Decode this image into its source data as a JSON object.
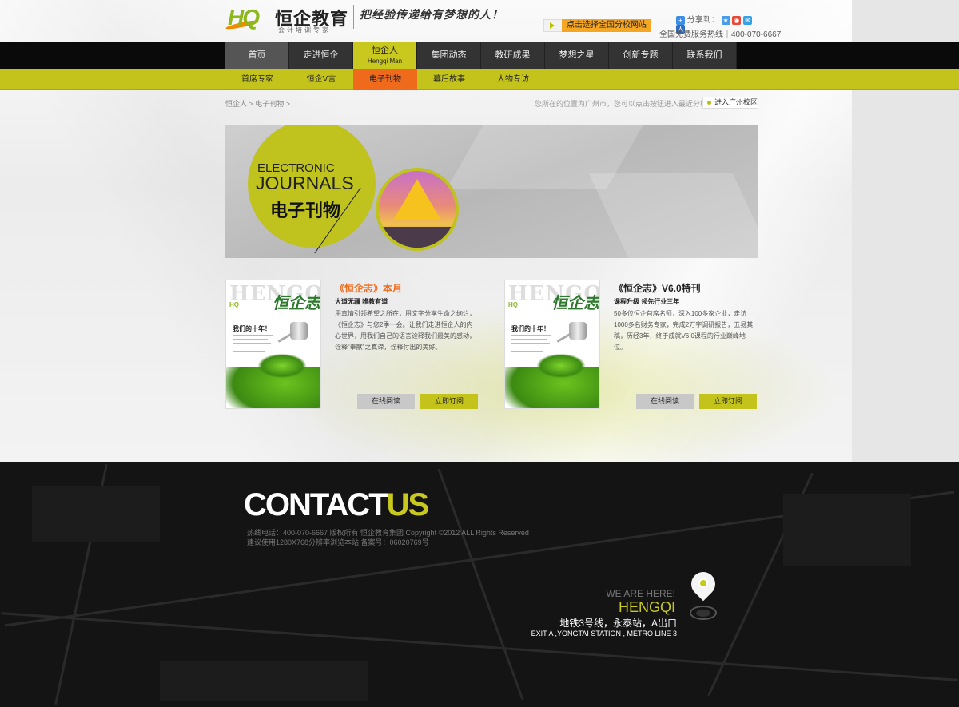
{
  "header": {
    "logo_mark": "HQ",
    "logo_name": "恒企教育",
    "logo_sub": "会计培训专家",
    "slogan": "把经验传递给有梦想的人！",
    "share_label": "分享到：",
    "select_school_label": "点击选择全国分校网站",
    "hotline": "全国免费服务热线｜400-070-6667"
  },
  "nav": {
    "items": [
      {
        "label": "首页"
      },
      {
        "label": "走进恒企"
      },
      {
        "label": "恒企人",
        "sub": "Hengqi Man"
      },
      {
        "label": "集团动态"
      },
      {
        "label": "教研成果"
      },
      {
        "label": "梦想之星"
      },
      {
        "label": "创新专题"
      },
      {
        "label": "联系我们"
      }
    ]
  },
  "subnav": {
    "items": [
      {
        "label": "首席专家"
      },
      {
        "label": "恒企V言"
      },
      {
        "label": "电子刊物"
      },
      {
        "label": "幕后故事"
      },
      {
        "label": "人物专访"
      }
    ]
  },
  "breadcrumb": "恒企人 > 电子刊物 >",
  "location_note": "您所在的位置为广州市，您可以点击按钮进入最近分校区",
  "enter_campus": "进入广州校区",
  "banner": {
    "en_line1": "ELECTRONIC",
    "en_line2": "JOURNALS",
    "cn": "电子刊物"
  },
  "journals": [
    {
      "cover_title": "HENGQI",
      "cover_script": "恒企志",
      "cover_hq": "HQ",
      "cover_line": "我们的十年！",
      "title": "《恒企志》本月",
      "title_color": "#f06a1c",
      "subtitle": "大道无疆 唯教有道",
      "desc": "用真情引领希望之所在，用文字分享生命之绚烂，《恒企志》与您2季一会。让我们走进恒企人的内心世界，用我们自己的语言诠释我们最美的感动，诠释“奉献”之真谛，诠释付出的美好。",
      "read_label": "在线阅读",
      "subscribe_label": "立即订阅"
    },
    {
      "cover_title": "HENGQI",
      "cover_script": "恒企志",
      "cover_hq": "HQ",
      "cover_line": "我们的十年！",
      "title": "《恒企志》V6.0特刊",
      "title_color": "#222222",
      "subtitle": "课程升级 领先行业三年",
      "desc": "50多位恒企首席名师，深入100多家企业，走访1000多名财务专家，完成2万字调研报告，五易其稿，历经3年，终于成就V6.0课程的行业巅峰地位。",
      "read_label": "在线阅读",
      "subscribe_label": "立即订阅"
    }
  ],
  "footer": {
    "contact_main": "CONTACT",
    "contact_accent": "US",
    "line1": "热线电话：400-070-6667 版权所有     恒企教育集团 Copyright ©2012 ALL Rights Reserved",
    "line2": "建议使用1280X768分辨率浏览本站 备案号：06020769号",
    "we_are_here": "WE ARE HERE!",
    "hengqi": "HENGQI",
    "address_cn": "地铁3号线，永泰站，A出口",
    "address_en": "EXIT A ,YONGTAI STATION , METRO LINE 3"
  },
  "colors": {
    "accent": "#c3c31c",
    "active_sub": "#f06a1c",
    "nav_dark": "#0a0a0a"
  }
}
